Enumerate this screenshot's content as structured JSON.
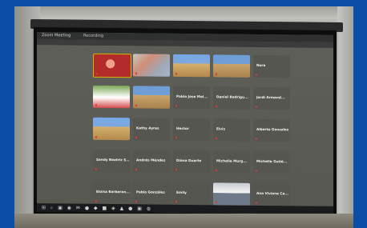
{
  "window": {
    "title": "Zoom Meeting",
    "tab": "Recording"
  },
  "participants": [
    {
      "name": "",
      "video": "red"
    },
    {
      "name": "",
      "video": "room"
    },
    {
      "name": "",
      "video": "sky"
    },
    {
      "name": "",
      "video": "person"
    },
    {
      "name": "Nora"
    },
    {
      "name": "",
      "video": "green"
    },
    {
      "name": "",
      "video": "person"
    },
    {
      "name": "Pablo Jose Mol..."
    },
    {
      "name": "Daniel Rodrigu..."
    },
    {
      "name": "Jordi Armand..."
    },
    {
      "name": "",
      "video": "sky"
    },
    {
      "name": "Kathy Ayres"
    },
    {
      "name": "Hector"
    },
    {
      "name": "Elvis"
    },
    {
      "name": "Alberto Gonzalez"
    },
    {
      "name": "Sandy Beatriz S..."
    },
    {
      "name": "Andrés Méndez"
    },
    {
      "name": "Diana Duarte"
    },
    {
      "name": "Michelle Murg..."
    },
    {
      "name": "Michelle Gutié..."
    },
    {
      "name": "Eloisa Barberan..."
    },
    {
      "name": "Pablo González"
    },
    {
      "name": "Emily"
    },
    {
      "name": "",
      "video": "silhouette"
    },
    {
      "name": "Ana Viviane Ca..."
    }
  ],
  "taskbar": {
    "icons": "⊞ ⌕ ▣ ◉ ✉ ● ◆ ■ ◈ ▲ ● ▣ ◍",
    "time": ""
  },
  "colors": {
    "border": "#0a4ea6",
    "screen": "#5a5b55",
    "taskbar": "#1a1b1d",
    "name_text": "#f3f3f3",
    "mic_muted": "#d83b3b"
  }
}
